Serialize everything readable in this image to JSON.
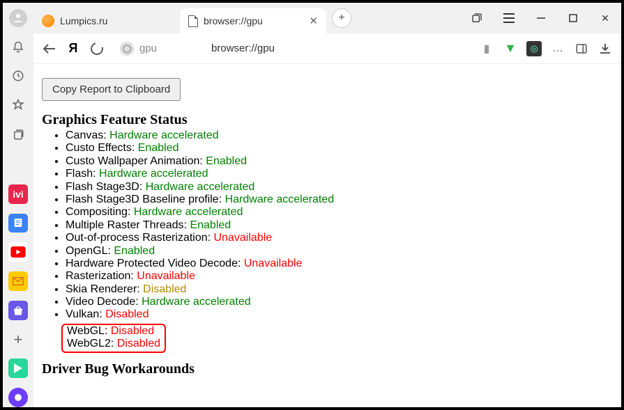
{
  "tabs": {
    "inactive_label": "Lumpics.ru",
    "active_label": "browser://gpu"
  },
  "addressbar": {
    "hint": "gpu",
    "url": "browser://gpu"
  },
  "page": {
    "copy_button": "Copy Report to Clipboard",
    "h_status": "Graphics Feature Status",
    "h_driver": "Driver Bug Workarounds",
    "features": [
      {
        "name": "Canvas",
        "value": "Hardware accelerated",
        "cls": "green"
      },
      {
        "name": "Custo Effects",
        "value": "Enabled",
        "cls": "green"
      },
      {
        "name": "Custo Wallpaper Animation",
        "value": "Enabled",
        "cls": "green"
      },
      {
        "name": "Flash",
        "value": "Hardware accelerated",
        "cls": "green"
      },
      {
        "name": "Flash Stage3D",
        "value": "Hardware accelerated",
        "cls": "green"
      },
      {
        "name": "Flash Stage3D Baseline profile",
        "value": "Hardware accelerated",
        "cls": "green"
      },
      {
        "name": "Compositing",
        "value": "Hardware accelerated",
        "cls": "green"
      },
      {
        "name": "Multiple Raster Threads",
        "value": "Enabled",
        "cls": "green"
      },
      {
        "name": "Out-of-process Rasterization",
        "value": "Unavailable",
        "cls": "red"
      },
      {
        "name": "OpenGL",
        "value": "Enabled",
        "cls": "green"
      },
      {
        "name": "Hardware Protected Video Decode",
        "value": "Unavailable",
        "cls": "red"
      },
      {
        "name": "Rasterization",
        "value": "Unavailable",
        "cls": "red"
      },
      {
        "name": "Skia Renderer",
        "value": "Disabled",
        "cls": "orange"
      },
      {
        "name": "Video Decode",
        "value": "Hardware accelerated",
        "cls": "green"
      },
      {
        "name": "Vulkan",
        "value": "Disabled",
        "cls": "red"
      }
    ],
    "webgl": [
      {
        "name": "WebGL",
        "value": "Disabled",
        "cls": "red"
      },
      {
        "name": "WebGL2",
        "value": "Disabled",
        "cls": "red"
      }
    ]
  }
}
